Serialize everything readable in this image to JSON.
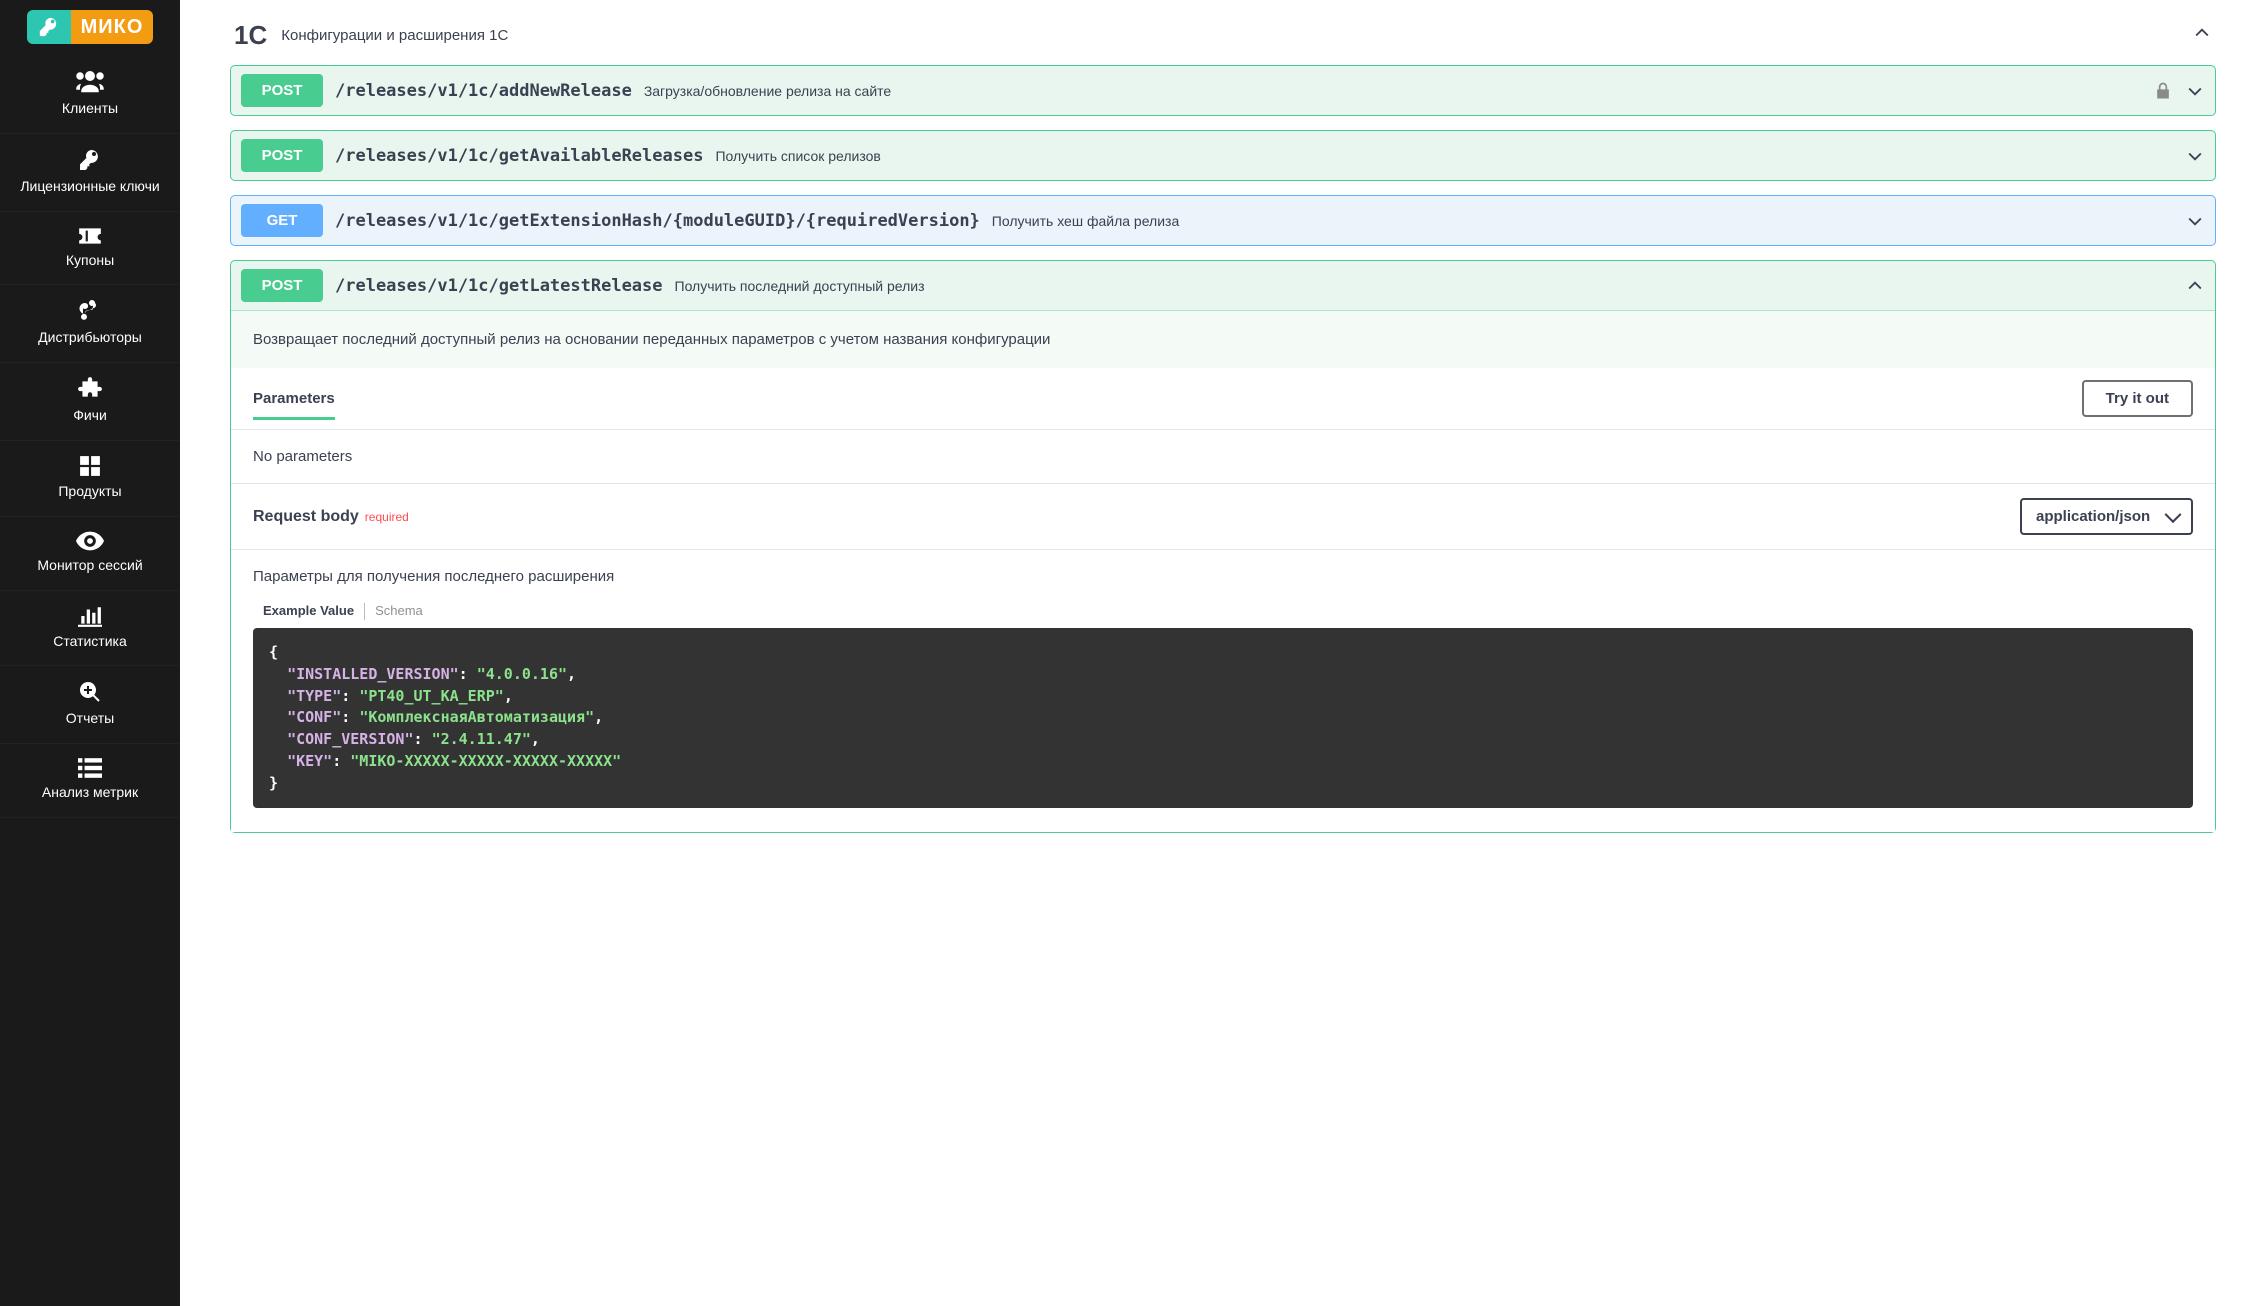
{
  "brand": {
    "name": "МИКО"
  },
  "sidebar": {
    "items": [
      {
        "label": "Клиенты"
      },
      {
        "label": "Лицензионные ключи"
      },
      {
        "label": "Купоны"
      },
      {
        "label": "Дистрибьюторы"
      },
      {
        "label": "Фичи"
      },
      {
        "label": "Продукты"
      },
      {
        "label": "Монитор сессий"
      },
      {
        "label": "Статистика"
      },
      {
        "label": "Отчеты"
      },
      {
        "label": "Анализ метрик"
      }
    ]
  },
  "section": {
    "tag": "1C",
    "description": "Конфигурации и расширения 1С"
  },
  "operations": [
    {
      "method": "POST",
      "path": "/releases/v1/1c/addNewRelease",
      "summary": "Загрузка/обновление релиза на сайте",
      "locked": true,
      "expanded": false
    },
    {
      "method": "POST",
      "path": "/releases/v1/1c/getAvailableReleases",
      "summary": "Получить список релизов",
      "locked": false,
      "expanded": false
    },
    {
      "method": "GET",
      "path": "/releases/v1/1c/getExtensionHash/{moduleGUID}/{requiredVersion}",
      "summary": "Получить хеш файла релиза",
      "locked": false,
      "expanded": false
    },
    {
      "method": "POST",
      "path": "/releases/v1/1c/getLatestRelease",
      "summary": "Получить последний доступный релиз",
      "locked": false,
      "expanded": true
    }
  ],
  "expanded": {
    "description": "Возвращает последний доступный релиз на основании переданных параметров с учетом названия конфигурации",
    "parameters_label": "Parameters",
    "try_label": "Try it out",
    "no_parameters": "No parameters",
    "request_body_label": "Request body",
    "required_label": "required",
    "content_type": "application/json",
    "body_desc": "Параметры для получения последнего расширения",
    "tabs": {
      "example": "Example Value",
      "schema": "Schema"
    },
    "example_json": {
      "INSTALLED_VERSION": "4.0.0.16",
      "TYPE": "PT40_UT_KA_ERP",
      "CONF": "КомплекснаяАвтоматизация",
      "CONF_VERSION": "2.4.11.47",
      "KEY": "MIKO-XXXXX-XXXXX-XXXXX-XXXXX"
    }
  }
}
